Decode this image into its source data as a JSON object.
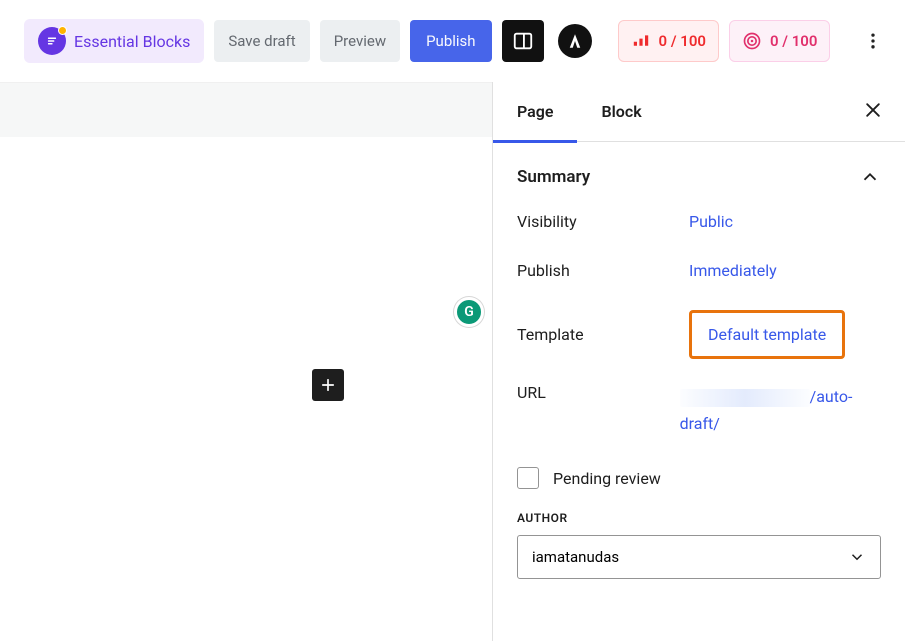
{
  "toolbar": {
    "essential_blocks": "Essential Blocks",
    "save_draft": "Save draft",
    "preview": "Preview",
    "publish": "Publish",
    "score1": "0 / 100",
    "score2": "0 / 100"
  },
  "sidebar": {
    "tabs": {
      "page": "Page",
      "block": "Block"
    },
    "summary": {
      "title": "Summary",
      "visibility": {
        "label": "Visibility",
        "value": "Public"
      },
      "publish": {
        "label": "Publish",
        "value": "Immediately"
      },
      "template": {
        "label": "Template",
        "value": "Default template"
      },
      "url": {
        "label": "URL",
        "value_visible": "/auto-draft/"
      },
      "pending_review": "Pending review",
      "author_label": "AUTHOR",
      "author_value": "iamatanudas"
    }
  },
  "canvas": {
    "grammarly": "G"
  }
}
